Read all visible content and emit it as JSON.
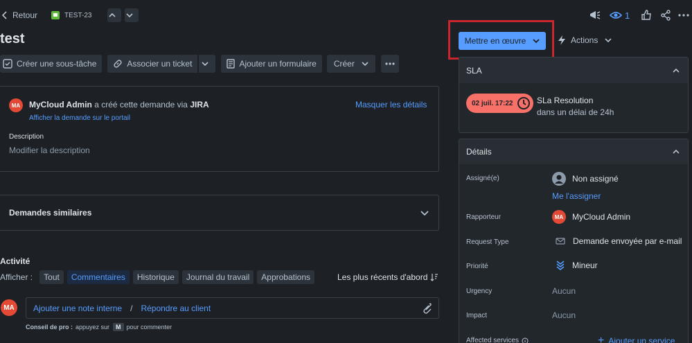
{
  "topbar": {
    "back_label": "Retour",
    "ticket_key": "TEST-23",
    "watch_count": "1"
  },
  "issue": {
    "title": "test"
  },
  "toolbar": {
    "create_subtask": "Créer une sous-tâche",
    "link_ticket": "Associer un ticket",
    "add_form": "Ajouter un formulaire",
    "create": "Créer"
  },
  "transition": {
    "status_button": "Mettre en œuvre",
    "actions_label": "Actions"
  },
  "request_card": {
    "avatar_initials": "MA",
    "creator": "MyCloud Admin",
    "created_text": "a créé cette demande via",
    "channel": "JIRA",
    "hide_details": "Masquer les détails",
    "portal_link": "Afficher la demande sur le portail",
    "description_label": "Description",
    "description_placeholder": "Modifier la description"
  },
  "similar": {
    "title": "Demandes similaires"
  },
  "activity": {
    "title": "Activité",
    "show_label": "Afficher :",
    "filters": [
      "Tout",
      "Commentaires",
      "Historique",
      "Journal du travail",
      "Approbations"
    ],
    "active_filter": "Commentaires",
    "sort_label": "Les plus récents d'abord",
    "composer_avatar": "MA",
    "internal_note": "Ajouter une note interne",
    "separator": "/",
    "reply_client": "Répondre au client",
    "tip_bold": "Conseil de pro :",
    "tip_text": "appuyez sur",
    "tip_key": "M",
    "tip_suffix": "pour commenter"
  },
  "sla": {
    "title": "SLA",
    "badge": "02 juil. 17:22",
    "badge_color": "#f87168",
    "name": "SLa Resolution",
    "subtitle": "dans un délai de 24h"
  },
  "details": {
    "title": "Détails",
    "assignee_label": "Assigné(e)",
    "assignee_value": "Non assigné",
    "assign_me": "Me l'assigner",
    "reporter_label": "Rapporteur",
    "reporter_initials": "MA",
    "reporter_value": "MyCloud Admin",
    "request_type_label": "Request Type",
    "request_type_value": "Demande envoyée par e-mail",
    "priority_label": "Priorité",
    "priority_value": "Mineur",
    "urgency_label": "Urgency",
    "urgency_value": "Aucun",
    "impact_label": "Impact",
    "impact_value": "Aucun",
    "affected_label": "Affected services",
    "add_service": "Ajouter un service"
  },
  "colors": {
    "primary": "#579dff",
    "highlight_box": "#c9252d",
    "avatar": "#e34935"
  }
}
